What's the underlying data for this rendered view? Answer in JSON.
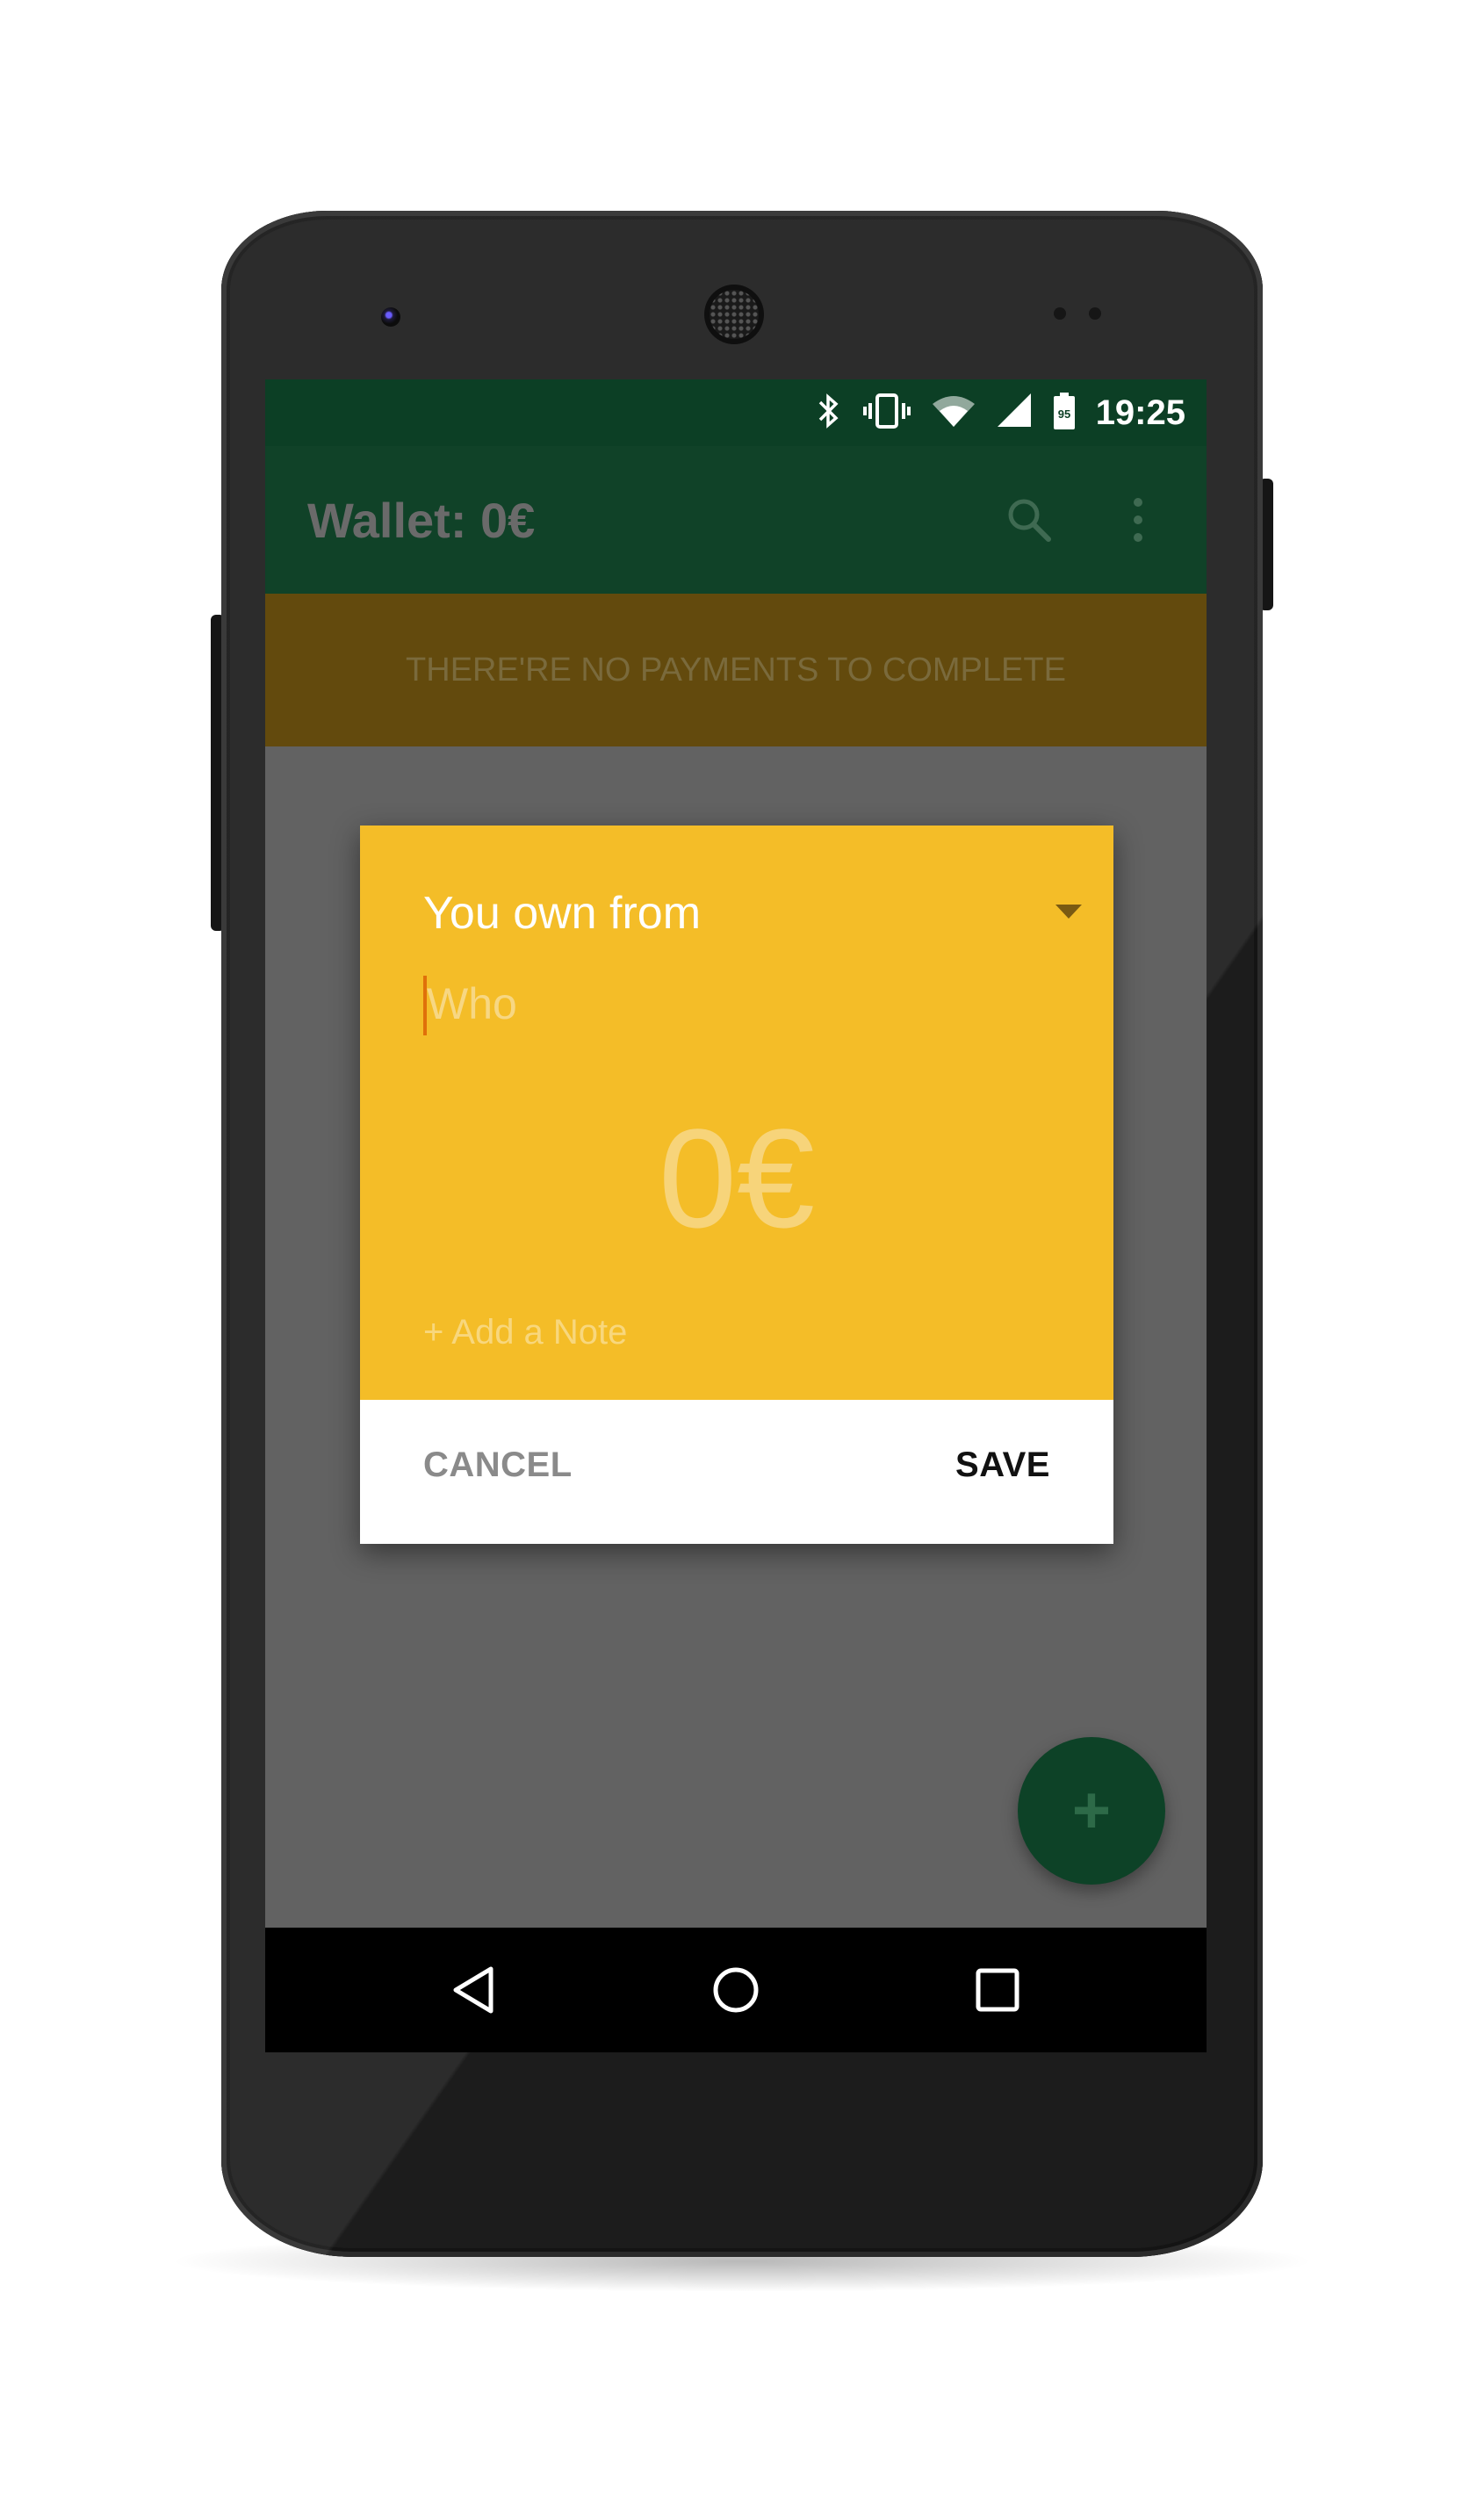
{
  "status_bar": {
    "icons": [
      "bluetooth-icon",
      "vibrate-icon",
      "wifi-icon",
      "cell-signal-icon",
      "battery-icon"
    ],
    "battery_level": "95",
    "time": "19:25"
  },
  "app_bar": {
    "title": "Wallet: 0€",
    "icons": [
      "search-icon",
      "overflow-menu-icon"
    ]
  },
  "banner": {
    "text": "THERE'RE NO PAYMENTS TO COMPLETE"
  },
  "dialog": {
    "type_selected": "You own from",
    "who_placeholder": "Who",
    "who_value": "",
    "amount": "0€",
    "note_link": "+ Add a Note",
    "cancel_label": "CANCEL",
    "save_label": "SAVE"
  },
  "fab": {
    "label": "+"
  },
  "nav_bar": {
    "icons": [
      "back-icon",
      "home-icon",
      "recents-icon"
    ]
  },
  "colors": {
    "primary_dark": "#0c3f25",
    "primary": "#104228",
    "banner": "#634a0d",
    "dialog_accent": "#f4bd28",
    "scrim": "#626262"
  }
}
